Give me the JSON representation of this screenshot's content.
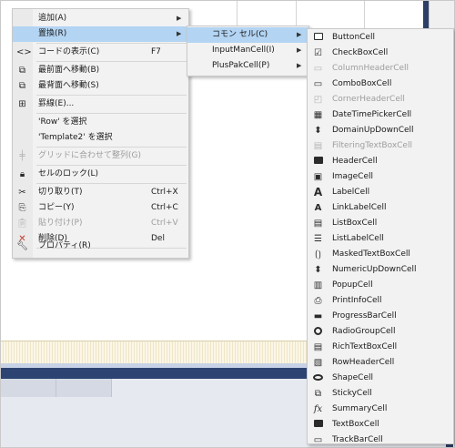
{
  "context_menu": {
    "items": [
      {
        "label": "追加(A)",
        "shortcut": "",
        "submenu": true,
        "disabled": false,
        "icon": "none"
      },
      {
        "label": "置換(R)",
        "shortcut": "",
        "submenu": true,
        "disabled": false,
        "icon": "none"
      },
      {
        "label": "コードの表示(C)",
        "shortcut": "F7",
        "submenu": false,
        "disabled": false,
        "icon": "code-icon"
      },
      {
        "label": "最前面へ移動(B)",
        "shortcut": "",
        "submenu": false,
        "disabled": false,
        "icon": "bring-to-front-icon"
      },
      {
        "label": "最背面へ移動(S)",
        "shortcut": "",
        "submenu": false,
        "disabled": false,
        "icon": "send-to-back-icon"
      },
      {
        "label": "罫線(E)...",
        "shortcut": "",
        "submenu": false,
        "disabled": false,
        "icon": "grid-border-icon"
      },
      {
        "label": "'Row' を選択",
        "shortcut": "",
        "submenu": false,
        "disabled": false,
        "icon": "none"
      },
      {
        "label": "'Template2' を選択",
        "shortcut": "",
        "submenu": false,
        "disabled": false,
        "icon": "none"
      },
      {
        "label": "グリッドに合わせて整列(G)",
        "shortcut": "",
        "submenu": false,
        "disabled": true,
        "icon": "align-grid-icon"
      },
      {
        "label": "セルのロック(L)",
        "shortcut": "",
        "submenu": false,
        "disabled": false,
        "icon": "lock-icon"
      },
      {
        "label": "切り取り(T)",
        "shortcut": "Ctrl+X",
        "submenu": false,
        "disabled": false,
        "icon": "cut-icon"
      },
      {
        "label": "コピー(Y)",
        "shortcut": "Ctrl+C",
        "submenu": false,
        "disabled": false,
        "icon": "copy-icon"
      },
      {
        "label": "貼り付け(P)",
        "shortcut": "Ctrl+V",
        "submenu": false,
        "disabled": true,
        "icon": "paste-icon"
      },
      {
        "label": "削除(D)",
        "shortcut": "Del",
        "submenu": false,
        "disabled": false,
        "icon": "delete-icon"
      },
      {
        "label": "プロパティ(R)",
        "shortcut": "",
        "submenu": false,
        "disabled": false,
        "icon": "wrench-icon"
      }
    ],
    "highlighted_index": 1
  },
  "replace_submenu": {
    "items": [
      {
        "label": "コモン セル(C)",
        "submenu": true
      },
      {
        "label": "InputManCell(I)",
        "submenu": true
      },
      {
        "label": "PlusPakCell(P)",
        "submenu": true
      }
    ],
    "highlighted_index": 0
  },
  "common_cell_submenu": {
    "items": [
      {
        "label": "ButtonCell",
        "disabled": false,
        "icon": "button-cell-icon"
      },
      {
        "label": "CheckBoxCell",
        "disabled": false,
        "icon": "checkbox-cell-icon"
      },
      {
        "label": "ColumnHeaderCell",
        "disabled": true,
        "icon": "column-header-cell-icon"
      },
      {
        "label": "ComboBoxCell",
        "disabled": false,
        "icon": "combobox-cell-icon"
      },
      {
        "label": "CornerHeaderCell",
        "disabled": true,
        "icon": "corner-header-cell-icon"
      },
      {
        "label": "DateTimePickerCell",
        "disabled": false,
        "icon": "datetime-picker-cell-icon"
      },
      {
        "label": "DomainUpDownCell",
        "disabled": false,
        "icon": "domain-updown-cell-icon"
      },
      {
        "label": "FilteringTextBoxCell",
        "disabled": true,
        "icon": "filtering-textbox-cell-icon"
      },
      {
        "label": "HeaderCell",
        "disabled": false,
        "icon": "header-cell-icon"
      },
      {
        "label": "ImageCell",
        "disabled": false,
        "icon": "image-cell-icon"
      },
      {
        "label": "LabelCell",
        "disabled": false,
        "icon": "label-cell-icon"
      },
      {
        "label": "LinkLabelCell",
        "disabled": false,
        "icon": "link-label-cell-icon"
      },
      {
        "label": "ListBoxCell",
        "disabled": false,
        "icon": "listbox-cell-icon"
      },
      {
        "label": "ListLabelCell",
        "disabled": false,
        "icon": "list-label-cell-icon"
      },
      {
        "label": "MaskedTextBoxCell",
        "disabled": false,
        "icon": "masked-textbox-cell-icon"
      },
      {
        "label": "NumericUpDownCell",
        "disabled": false,
        "icon": "numeric-updown-cell-icon"
      },
      {
        "label": "PopupCell",
        "disabled": false,
        "icon": "popup-cell-icon"
      },
      {
        "label": "PrintInfoCell",
        "disabled": false,
        "icon": "print-info-cell-icon"
      },
      {
        "label": "ProgressBarCell",
        "disabled": false,
        "icon": "progressbar-cell-icon"
      },
      {
        "label": "RadioGroupCell",
        "disabled": false,
        "icon": "radio-group-cell-icon"
      },
      {
        "label": "RichTextBoxCell",
        "disabled": false,
        "icon": "rich-textbox-cell-icon"
      },
      {
        "label": "RowHeaderCell",
        "disabled": false,
        "icon": "row-header-cell-icon"
      },
      {
        "label": "ShapeCell",
        "disabled": false,
        "icon": "shape-cell-icon"
      },
      {
        "label": "StickyCell",
        "disabled": false,
        "icon": "sticky-cell-icon"
      },
      {
        "label": "SummaryCell",
        "disabled": false,
        "icon": "summary-cell-icon"
      },
      {
        "label": "TextBoxCell",
        "disabled": false,
        "icon": "textbox-cell-icon"
      },
      {
        "label": "TrackBarCell",
        "disabled": false,
        "icon": "trackbar-cell-icon"
      }
    ]
  },
  "colors": {
    "menu_background": "#f2f2f2",
    "highlight": "#b3d4f3",
    "disabled_text": "#9d9d9d",
    "designer_band": "#2d4472"
  }
}
